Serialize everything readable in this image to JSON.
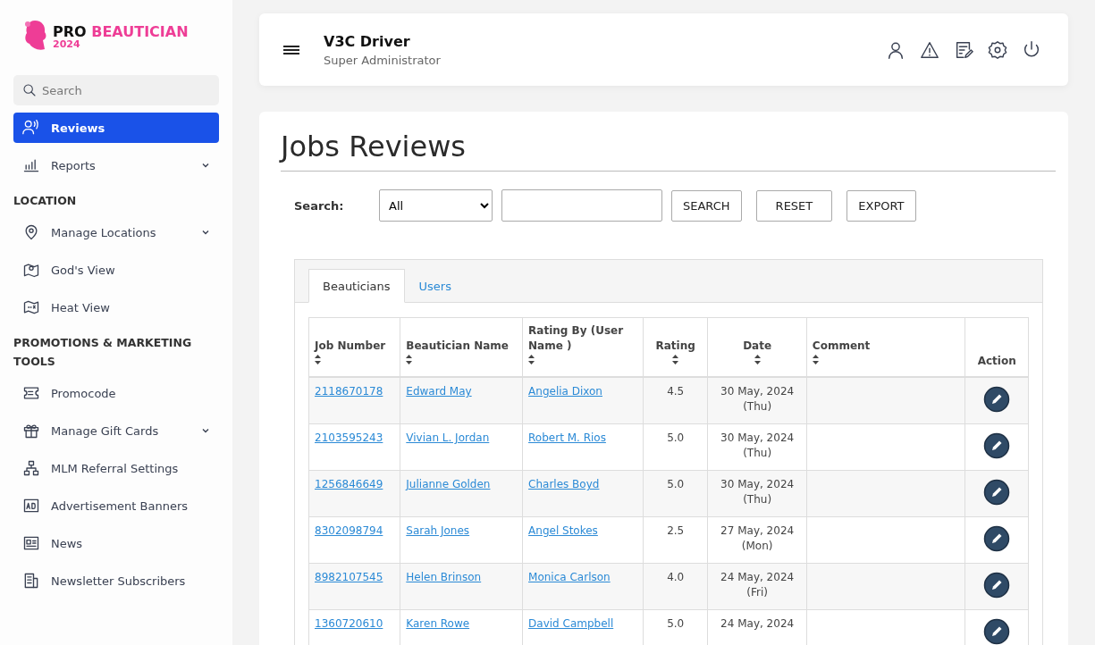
{
  "brand": {
    "name": "PRO",
    "accent": "BEAUTICIAN",
    "year": "2024"
  },
  "sidebar": {
    "search": {
      "placeholder": "Search"
    },
    "items": [
      {
        "kind": "item",
        "label": "Reviews",
        "selected": true,
        "expandable": false
      },
      {
        "kind": "item",
        "label": "Reports",
        "selected": false,
        "expandable": true
      },
      {
        "kind": "section",
        "label": "LOCATION"
      },
      {
        "kind": "item",
        "label": "Manage Locations",
        "selected": false,
        "expandable": true
      },
      {
        "kind": "item",
        "label": "God's View",
        "selected": false,
        "expandable": false
      },
      {
        "kind": "item",
        "label": "Heat View",
        "selected": false,
        "expandable": false
      },
      {
        "kind": "section",
        "label": "PROMOTIONS & MARKETING TOOLS"
      },
      {
        "kind": "item",
        "label": "Promocode",
        "selected": false,
        "expandable": false
      },
      {
        "kind": "item",
        "label": "Manage Gift Cards",
        "selected": false,
        "expandable": true
      },
      {
        "kind": "item",
        "label": "MLM Referral Settings",
        "selected": false,
        "expandable": false
      },
      {
        "kind": "item",
        "label": "Advertisement Banners",
        "selected": false,
        "expandable": false
      },
      {
        "kind": "item",
        "label": "News",
        "selected": false,
        "expandable": false
      },
      {
        "kind": "item",
        "label": "Newsletter Subscribers",
        "selected": false,
        "expandable": false
      }
    ]
  },
  "header": {
    "title": "V3C Driver",
    "subtitle": "Super Administrator"
  },
  "page": {
    "title": "Jobs Reviews",
    "filter": {
      "label": "Search:",
      "select_value": "All",
      "buttons": [
        "SEARCH",
        "RESET",
        "EXPORT"
      ]
    },
    "tabs": [
      {
        "label": "Beauticians",
        "selected": true
      },
      {
        "label": "Users",
        "selected": false
      }
    ],
    "table": {
      "columns": [
        {
          "label": "Job Number",
          "sortable": true
        },
        {
          "label": "Beautician Name",
          "sortable": true
        },
        {
          "label": "Rating By (User Name )",
          "sortable": true
        },
        {
          "label": "Rating",
          "sortable": true
        },
        {
          "label": "Date",
          "sortable": true
        },
        {
          "label": "Comment",
          "sortable": true
        },
        {
          "label": "Action",
          "sortable": false
        }
      ],
      "rows": [
        {
          "job": "2118670178",
          "beautician": "Edward May",
          "user": "Angelia Dixon",
          "rating": "4.5",
          "date": "30 May, 2024",
          "day": "(Thu)"
        },
        {
          "job": "2103595243",
          "beautician": "Vivian L. Jordan",
          "user": "Robert M. Rios",
          "rating": "5.0",
          "date": "30 May, 2024",
          "day": "(Thu)"
        },
        {
          "job": "1256846649",
          "beautician": "Julianne Golden",
          "user": "Charles Boyd",
          "rating": "5.0",
          "date": "30 May, 2024",
          "day": "(Thu)"
        },
        {
          "job": "8302098794",
          "beautician": "Sarah Jones",
          "user": "Angel Stokes",
          "rating": "2.5",
          "date": "27 May, 2024",
          "day": "(Mon)"
        },
        {
          "job": "8982107545",
          "beautician": "Helen Brinson",
          "user": "Monica Carlson",
          "rating": "4.0",
          "date": "24 May, 2024",
          "day": "(Fri)"
        },
        {
          "job": "1360720610",
          "beautician": "Karen Rowe",
          "user": "David Campbell",
          "rating": "5.0",
          "date": "24 May, 2024"
        }
      ]
    }
  }
}
